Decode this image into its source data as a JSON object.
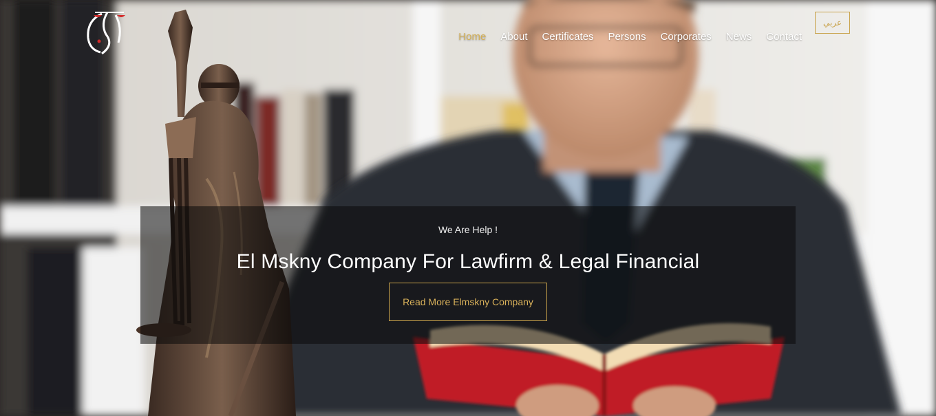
{
  "nav": {
    "items": [
      {
        "label": "Home",
        "active": true
      },
      {
        "label": "About",
        "active": false
      },
      {
        "label": "Certificates",
        "active": false
      },
      {
        "label": "Persons",
        "active": false
      },
      {
        "label": "Corporates",
        "active": false
      },
      {
        "label": "News",
        "active": false
      },
      {
        "label": "Contact",
        "active": false
      }
    ],
    "language_button": "عربي"
  },
  "logo": {
    "icon": "scales-logo-icon"
  },
  "hero": {
    "eyebrow": "We Are Help !",
    "headline": "El Mskny Company For Lawfirm & Legal Financial",
    "cta_label": "Read More Elmskny Company"
  },
  "colors": {
    "accent": "#d4b056",
    "overlay": "rgba(10,10,10,0.55)",
    "text": "#ffffff"
  }
}
